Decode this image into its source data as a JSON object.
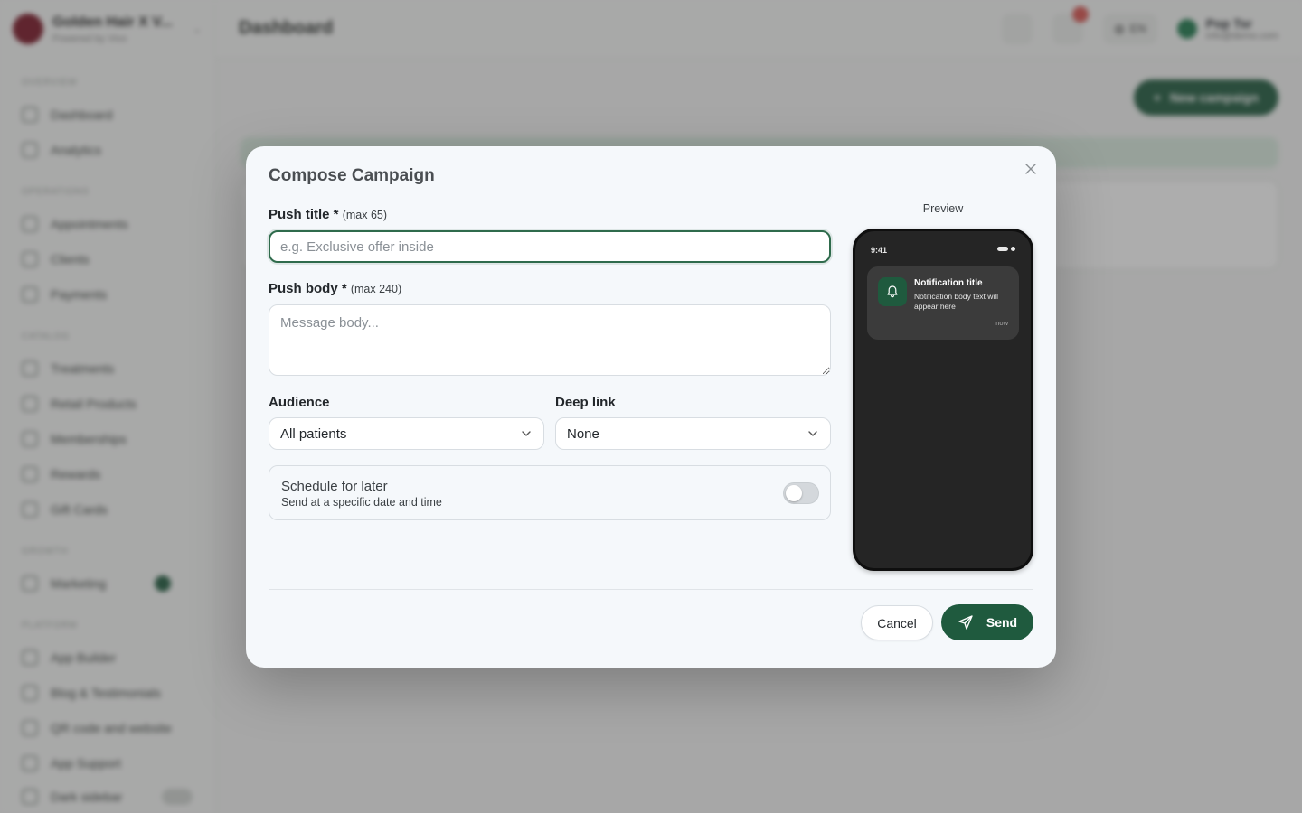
{
  "background": {
    "brand": {
      "name": "Golden Hair X V...",
      "subtitle": "Powered by Vivo"
    },
    "page_title": "Dashboard",
    "nav_sections": [
      {
        "label": "Overview",
        "items": [
          "Dashboard",
          "Analytics"
        ]
      },
      {
        "label": "Operations",
        "items": [
          "Appointments",
          "Clients",
          "Payments"
        ]
      },
      {
        "label": "Catalog",
        "items": [
          "Treatments",
          "Retail Products",
          "Memberships",
          "Rewards",
          "Gift Cards"
        ]
      },
      {
        "label": "Growth",
        "items": [
          "Marketing"
        ]
      },
      {
        "label": "Platform",
        "items": [
          "App Builder",
          "Blog & Testimonials",
          "QR code and website",
          "App Support"
        ]
      }
    ],
    "dark_sidebar_label": "Dark sidebar",
    "language": "EN",
    "user": {
      "name": "Pop Tsr",
      "email": "info@demo.com"
    },
    "new_campaign_label": "New campaign"
  },
  "modal": {
    "title": "Compose Campaign",
    "push_title": {
      "label": "Push title *",
      "hint": "(max 65)",
      "value": "",
      "placeholder": "e.g. Exclusive offer inside"
    },
    "push_body": {
      "label": "Push body *",
      "hint": "(max 240)",
      "value": "",
      "placeholder": "Message body..."
    },
    "audience": {
      "label": "Audience",
      "selected": "All patients"
    },
    "deep_link": {
      "label": "Deep link",
      "selected": "None"
    },
    "schedule": {
      "title": "Schedule for later",
      "subtitle": "Send at a specific date and time",
      "enabled": false
    },
    "cancel_label": "Cancel",
    "send_label": "Send"
  },
  "preview": {
    "label": "Preview",
    "time": "9:41",
    "notification": {
      "title": "Notification title",
      "body": "Notification body text will appear here",
      "timestamp": "now"
    }
  },
  "colors": {
    "accent": "#1f5a3e",
    "phone": "#252525",
    "modal_bg": "#f5f8fb"
  }
}
